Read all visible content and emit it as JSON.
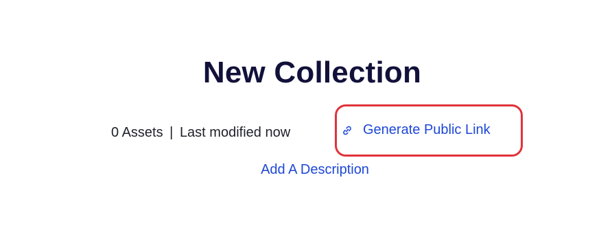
{
  "collection": {
    "title": "New Collection",
    "asset_count": "0 Assets",
    "separator": "|",
    "last_modified": "Last modified now"
  },
  "actions": {
    "generate_public_link": "Generate Public Link",
    "add_description": "Add A Description"
  },
  "icons": {
    "link": "link-icon"
  },
  "colors": {
    "title": "#12113a",
    "link": "#1d47d6",
    "highlight": "#e0323a",
    "text": "#1f1f2a"
  }
}
